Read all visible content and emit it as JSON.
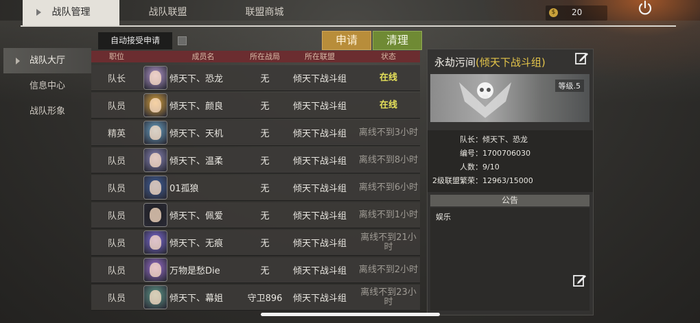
{
  "tabs": [
    {
      "label": "战队管理",
      "active": true
    },
    {
      "label": "战队联盟",
      "active": false
    },
    {
      "label": "联盟商城",
      "active": false
    }
  ],
  "currency": {
    "icon": "coin-icon",
    "value": "20"
  },
  "nav": [
    {
      "label": "战队大厅",
      "active": true
    },
    {
      "label": "信息中心",
      "active": false
    },
    {
      "label": "战队形象",
      "active": false
    }
  ],
  "controls": {
    "auto_accept_label": "自动接受申请",
    "apply_label": "申请",
    "clear_label": "清理",
    "apply_color": "#b88d3a",
    "clear_color": "#6f8a34"
  },
  "table": {
    "headers": {
      "role": "职位",
      "name": "成员名",
      "zone": "所在战局",
      "alliance": "所在联盟",
      "status": "状态"
    },
    "rows": [
      {
        "role": "队长",
        "name": "倾天下、恐龙",
        "zone": "无",
        "alliance": "倾天下战斗组",
        "status": "在线",
        "online": true,
        "avatar_color": "#b79ad0"
      },
      {
        "role": "队员",
        "name": "倾天下、颜良",
        "zone": "无",
        "alliance": "倾天下战斗组",
        "status": "在线",
        "online": true,
        "avatar_color": "#d9a23a"
      },
      {
        "role": "精英",
        "name": "倾天下、天机",
        "zone": "无",
        "alliance": "倾天下战斗组",
        "status": "离线不到3小时",
        "online": false,
        "avatar_color": "#6aa3c4"
      },
      {
        "role": "队员",
        "name": "倾天下、温柔",
        "zone": "无",
        "alliance": "倾天下战斗组",
        "status": "离线不到8小时",
        "online": false,
        "avatar_color": "#8a86b8"
      },
      {
        "role": "队员",
        "name": "01孤狼",
        "zone": "无",
        "alliance": "倾天下战斗组",
        "status": "离线不到6小时",
        "online": false,
        "avatar_color": "#3f5f9a"
      },
      {
        "role": "队员",
        "name": "倾天下、佩爱",
        "zone": "无",
        "alliance": "倾天下战斗组",
        "status": "离线不到1小时",
        "online": false,
        "avatar_color": "#1e1e22"
      },
      {
        "role": "队员",
        "name": "倾天下、无痕",
        "zone": "无",
        "alliance": "倾天下战斗组",
        "status": "离线不到21小时",
        "online": false,
        "avatar_color": "#7c6ad6"
      },
      {
        "role": "队员",
        "name": "万物是愁Die",
        "zone": "无",
        "alliance": "倾天下战斗组",
        "status": "离线不到2小时",
        "online": false,
        "avatar_color": "#9b6fd0"
      },
      {
        "role": "队员",
        "name": "倾天下、幕姐",
        "zone": "守卫896",
        "alliance": "倾天下战斗组",
        "status": "离线不到23小时",
        "online": false,
        "avatar_color": "#5f9a8a"
      }
    ]
  },
  "team": {
    "name": "永劫污间",
    "alliance_tag": "(倾天下战斗组)",
    "level_badge": "等级.5",
    "leader_label": "队长：",
    "leader_value": "倾天下、恐龙",
    "id_label": "编号：",
    "id_value": "1700706030",
    "members_label": "人数：",
    "members_value": "9/10",
    "prosperity_label": "2级联盟繁荣：",
    "prosperity_value": "12963/15000",
    "notice_title": "公告",
    "notice_text": "娱乐"
  }
}
